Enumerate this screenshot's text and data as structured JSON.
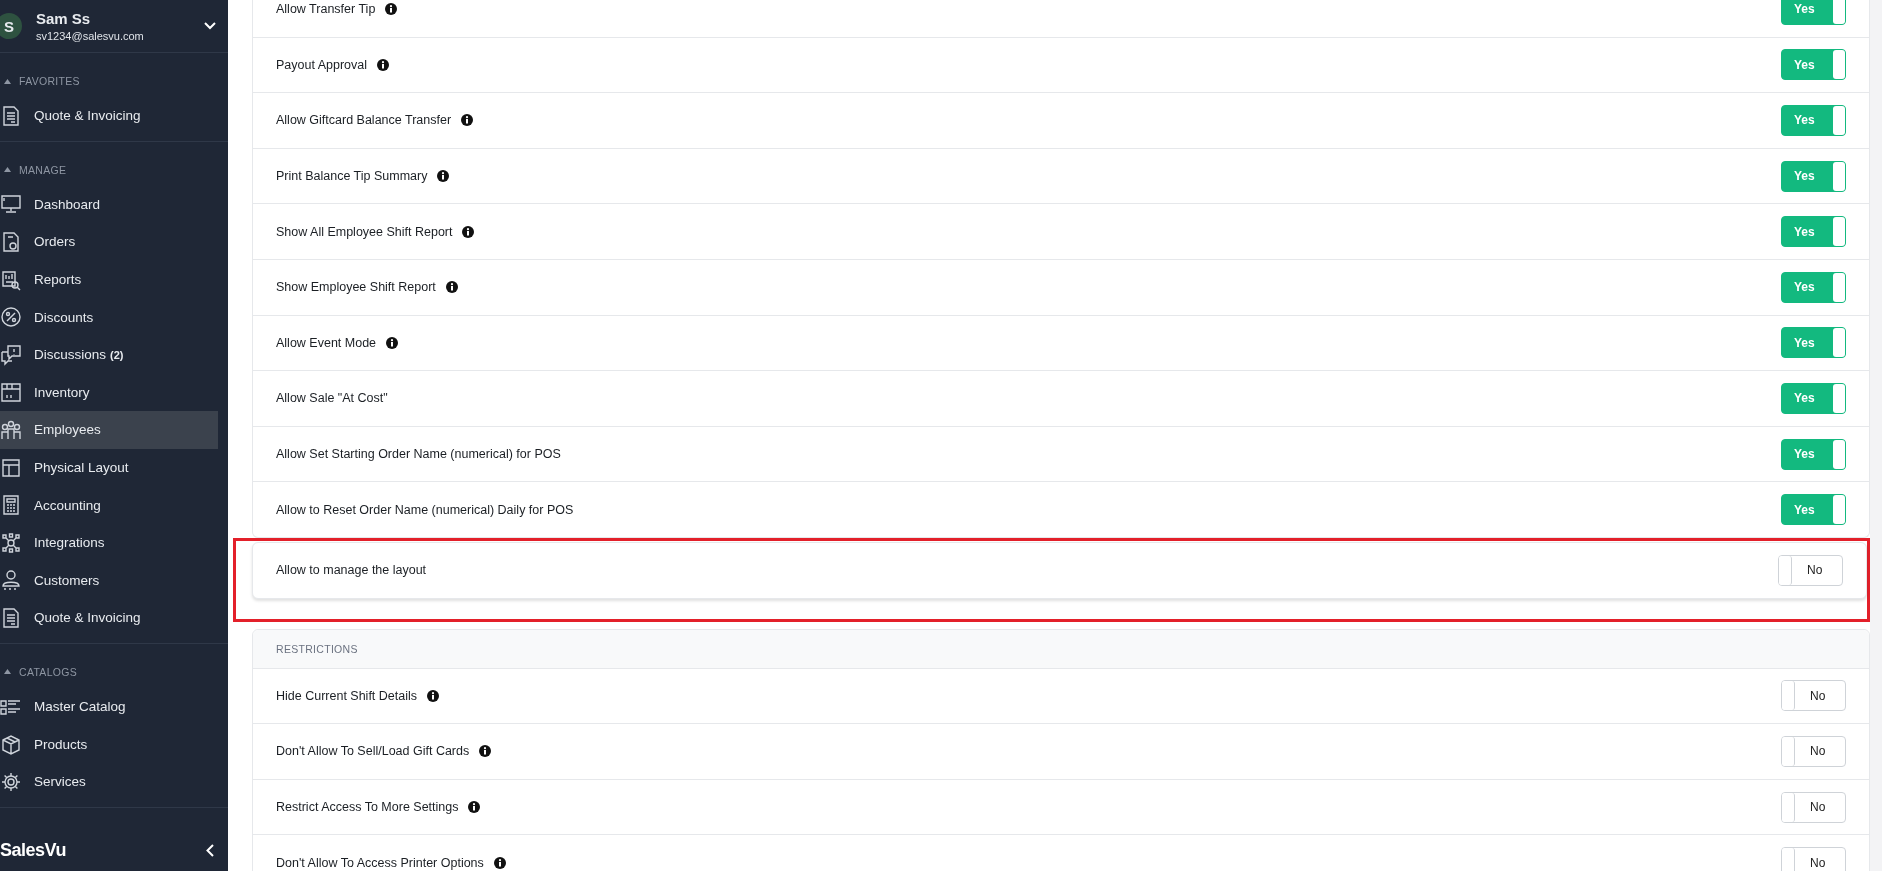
{
  "sidebar": {
    "user": {
      "initial": "S",
      "name": "Sam Ss",
      "email": "sv1234@salesvu.com"
    },
    "sections": [
      {
        "title": "FAVORITES",
        "items": [
          {
            "label": "Quote & Invoicing",
            "selected": false
          }
        ]
      },
      {
        "title": "MANAGE",
        "items": [
          {
            "label": "Dashboard",
            "selected": false
          },
          {
            "label": "Orders",
            "selected": false
          },
          {
            "label": "Reports",
            "selected": false
          },
          {
            "label": "Discounts",
            "selected": false
          },
          {
            "label": "Discussions",
            "badge": "(2)",
            "selected": false
          },
          {
            "label": "Inventory",
            "selected": false
          },
          {
            "label": "Employees",
            "selected": true
          },
          {
            "label": "Physical Layout",
            "selected": false
          },
          {
            "label": "Accounting",
            "selected": false
          },
          {
            "label": "Integrations",
            "selected": false
          },
          {
            "label": "Customers",
            "selected": false
          },
          {
            "label": "Quote & Invoicing",
            "selected": false
          }
        ]
      },
      {
        "title": "CATALOGS",
        "items": [
          {
            "label": "Master Catalog",
            "selected": false
          },
          {
            "label": "Products",
            "selected": false
          },
          {
            "label": "Services",
            "selected": false
          }
        ]
      }
    ],
    "logo": "SalesVu"
  },
  "settings": [
    {
      "highlighted": false,
      "rows": [
        {
          "label": "Allow Transfer Tip",
          "info": true,
          "on": true,
          "value": "Yes"
        },
        {
          "label": "Payout Approval",
          "info": true,
          "on": true,
          "value": "Yes"
        },
        {
          "label": "Allow Giftcard Balance Transfer",
          "info": true,
          "on": true,
          "value": "Yes"
        },
        {
          "label": "Print Balance Tip Summary",
          "info": true,
          "on": true,
          "value": "Yes"
        },
        {
          "label": "Show All Employee Shift Report",
          "info": true,
          "on": true,
          "value": "Yes"
        },
        {
          "label": "Show Employee Shift Report",
          "info": true,
          "on": true,
          "value": "Yes"
        },
        {
          "label": "Allow Event Mode",
          "info": true,
          "on": true,
          "value": "Yes"
        },
        {
          "label": "Allow Sale \"At Cost\"",
          "info": false,
          "on": true,
          "value": "Yes"
        },
        {
          "label": "Allow Set Starting Order Name (numerical) for POS",
          "info": false,
          "on": true,
          "value": "Yes"
        },
        {
          "label": "Allow to Reset Order Name (numerical) Daily for POS",
          "info": false,
          "on": true,
          "value": "Yes"
        }
      ]
    },
    {
      "highlighted": true,
      "rows": [
        {
          "label": "Allow to manage the layout",
          "info": false,
          "on": false,
          "value": "No"
        }
      ]
    },
    {
      "highlighted": false,
      "title": "RESTRICTIONS",
      "rows": [
        {
          "label": "Hide Current Shift Details",
          "info": true,
          "on": false,
          "value": "No"
        },
        {
          "label": "Don't Allow To Sell/Load Gift Cards",
          "info": true,
          "on": false,
          "value": "No"
        },
        {
          "label": "Restrict Access To More Settings",
          "info": true,
          "on": false,
          "value": "No"
        },
        {
          "label": "Don't Allow To Access Printer Options",
          "info": true,
          "on": false,
          "value": "No"
        }
      ]
    }
  ]
}
